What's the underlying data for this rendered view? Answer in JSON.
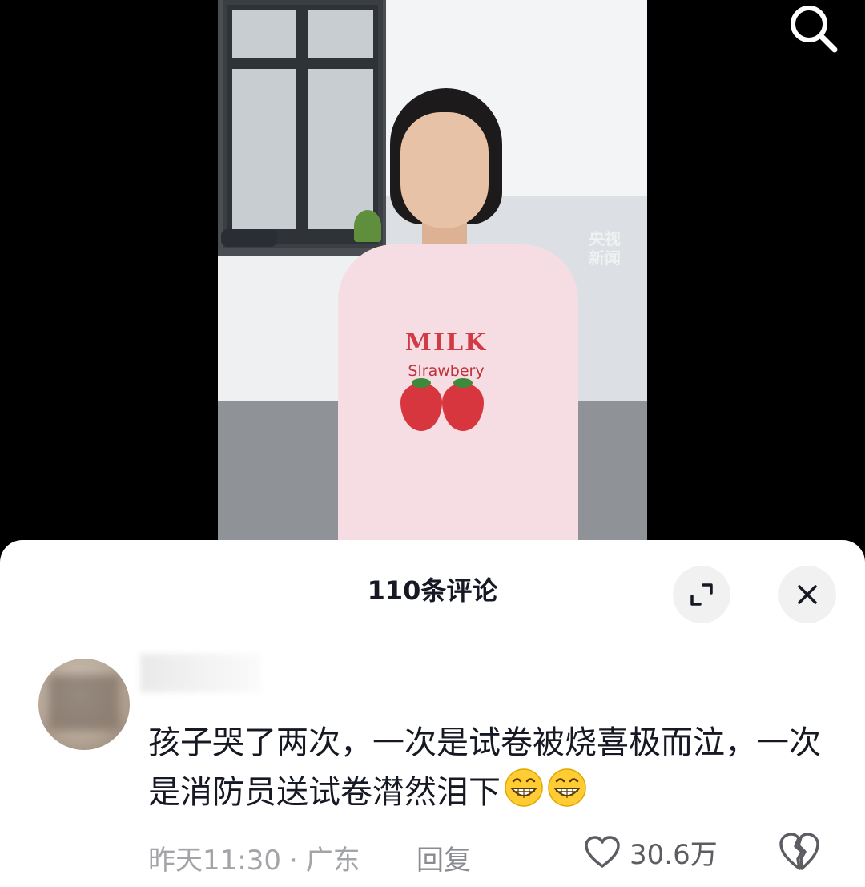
{
  "video": {
    "watermark": "央视\n新闻",
    "shirt_title": "MILK",
    "shirt_subtitle": "Slrawbery"
  },
  "header": {
    "search_icon": "search-icon"
  },
  "comments_panel": {
    "title": "110条评论",
    "expand_icon": "expand-icon",
    "close_icon": "close-icon"
  },
  "comment": {
    "text": "孩子哭了两次，一次是试卷被烧喜极而泣，一次是消防员送试卷潸然泪下",
    "emojis": [
      "grin-emoji",
      "grin-emoji"
    ],
    "time": "昨天11:30",
    "separator": "·",
    "location": "广东",
    "reply_label": "回复",
    "likes": "30.6万"
  },
  "colors": {
    "text_primary": "#161823",
    "text_secondary": "#a3a4a8",
    "panel_bg": "#ffffff",
    "button_bg": "#f1f1f2"
  }
}
